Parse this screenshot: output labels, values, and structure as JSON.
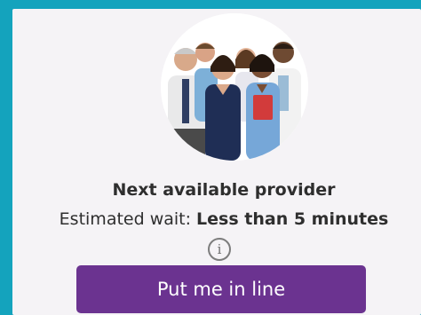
{
  "provider": {
    "title": "Next available provider",
    "wait_label": "Estimated wait: ",
    "wait_value": "Less than 5 minutes"
  },
  "actions": {
    "queue_button_label": "Put me in line"
  },
  "icons": {
    "info": "info-icon",
    "photo": "medical-team-photo"
  },
  "colors": {
    "page_background": "#14a3bd",
    "card_background": "#f5f3f6",
    "button_background": "#6b3390",
    "button_text": "#ffffff"
  }
}
